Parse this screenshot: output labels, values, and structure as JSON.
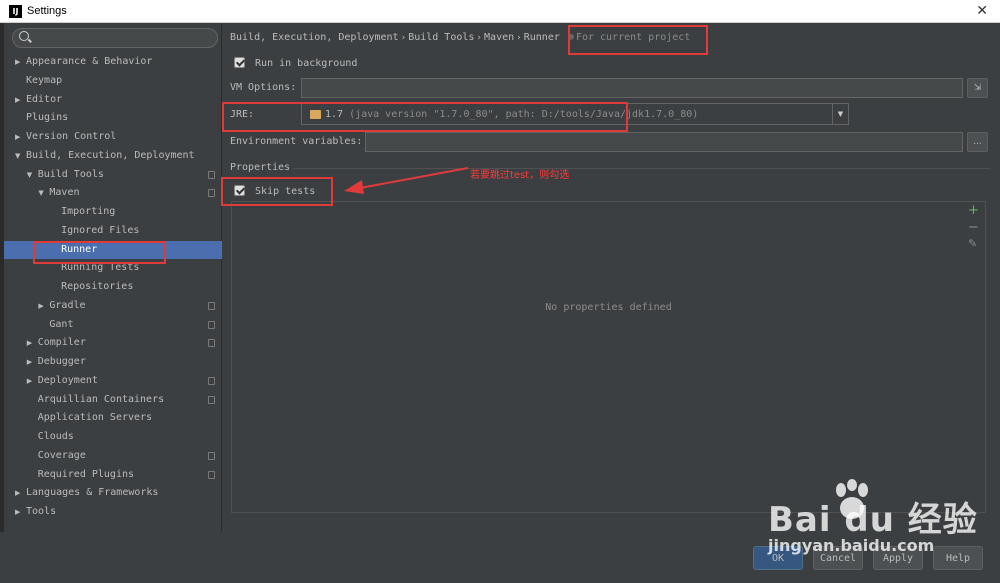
{
  "window": {
    "title": "Settings",
    "app_icon": "intellij-icon",
    "close": "✕"
  },
  "search": {
    "placeholder": ""
  },
  "tree": [
    {
      "label": "Appearance & Behavior",
      "arrow": "▶"
    },
    {
      "label": "Keymap",
      "arrow": ""
    },
    {
      "label": "Editor",
      "arrow": "▶"
    },
    {
      "label": "Plugins",
      "arrow": ""
    },
    {
      "label": "Version Control",
      "arrow": "▶"
    },
    {
      "label": "Build, Execution, Deployment",
      "arrow": "▼"
    },
    {
      "label": "Build Tools",
      "arrow": "▼"
    },
    {
      "label": "Maven",
      "arrow": "▼"
    },
    {
      "label": "Importing",
      "arrow": ""
    },
    {
      "label": "Ignored Files",
      "arrow": ""
    },
    {
      "label": "Runner",
      "arrow": ""
    },
    {
      "label": "Running Tests",
      "arrow": ""
    },
    {
      "label": "Repositories",
      "arrow": ""
    },
    {
      "label": "Gradle",
      "arrow": "▶"
    },
    {
      "label": "Gant",
      "arrow": ""
    },
    {
      "label": "Compiler",
      "arrow": "▶"
    },
    {
      "label": "Debugger",
      "arrow": "▶"
    },
    {
      "label": "Deployment",
      "arrow": "▶"
    },
    {
      "label": "Arquillian Containers",
      "arrow": ""
    },
    {
      "label": "Application Servers",
      "arrow": ""
    },
    {
      "label": "Clouds",
      "arrow": ""
    },
    {
      "label": "Coverage",
      "arrow": ""
    },
    {
      "label": "Required Plugins",
      "arrow": ""
    },
    {
      "label": "Languages & Frameworks",
      "arrow": "▶"
    },
    {
      "label": "Tools",
      "arrow": "▶"
    }
  ],
  "breadcrumb": {
    "items": [
      "Build, Execution, Deployment",
      "Build Tools",
      "Maven",
      "Runner"
    ],
    "separator": "›",
    "scope": "For current project"
  },
  "form": {
    "run_in_background": "Run in background",
    "vm_options_label": "VM Options:",
    "vm_options_value": "",
    "jre_label": "JRE:",
    "jre_version": "1.7",
    "jre_detail": "(java version \"1.7.0_80\", path: D:/tools/Java/jdk1.7.0_80)",
    "env_label": "Environment variables:",
    "env_value": "",
    "browse": "...",
    "dropdown_arrow": "▼"
  },
  "properties": {
    "section_title": "Properties",
    "skip_tests": "Skip tests",
    "empty_text": "No properties defined",
    "add": "+",
    "remove": "−",
    "edit": "✎"
  },
  "annotation": {
    "text": "若要跳过test，则勾选",
    "color": "#e03b3b"
  },
  "footer": {
    "ok": "OK",
    "cancel": "Cancel",
    "apply": "Apply",
    "help": "Help"
  },
  "watermark": {
    "brand": "Bai du 经验",
    "url": "jingyan.baidu.com"
  },
  "colors": {
    "selection": "#4b6eaf",
    "background": "#3c3f41",
    "annotation": "#e03b3b"
  }
}
